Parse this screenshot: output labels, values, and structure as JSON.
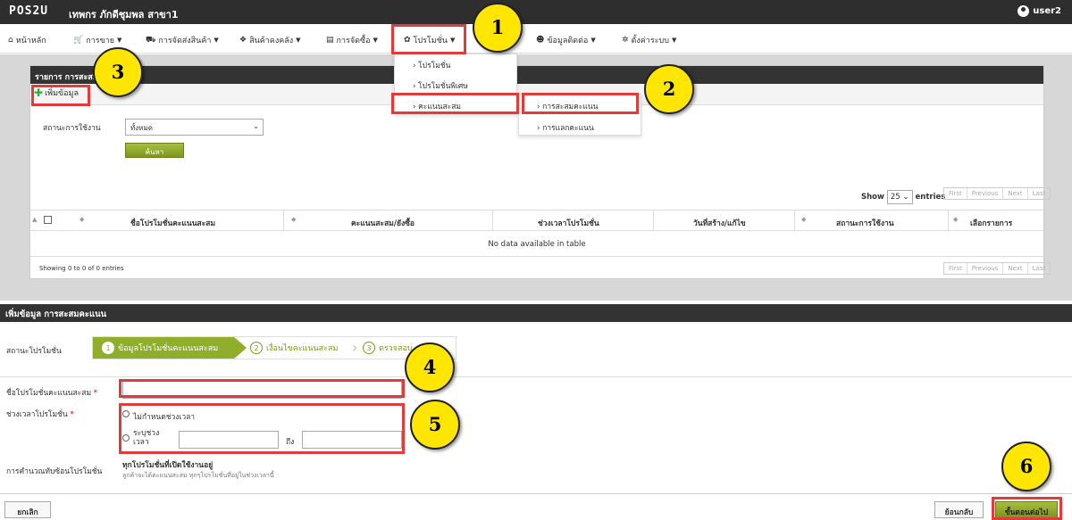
{
  "topbar": {
    "logo": "POS2U",
    "store_name": "เทพกร ภักดีชุมพล สาขา1",
    "user": "user2"
  },
  "nav": [
    {
      "label": "หน้าหลัก",
      "icon": "home-icon",
      "glyph": "⌂"
    },
    {
      "label": "การขาย",
      "icon": "cart-icon",
      "glyph": "🛒"
    },
    {
      "label": "การจัดส่งสินค้า",
      "icon": "truck-icon",
      "glyph": "⛟"
    },
    {
      "label": "สินค้าคงคลัง",
      "icon": "boxes-icon",
      "glyph": "❖"
    },
    {
      "label": "การจัดซื้อ",
      "icon": "document-icon",
      "glyph": "▤"
    },
    {
      "label": "โปรโมชั่น",
      "icon": "gift-icon",
      "glyph": "✿"
    },
    {
      "label": "ข้อมูลติดต่อ",
      "icon": "users-icon",
      "glyph": "☻"
    },
    {
      "label": "ตั้งค่าระบบ",
      "icon": "gear-icon",
      "glyph": "✲"
    }
  ],
  "promo_menu": {
    "items": [
      "โปรโมชั่น",
      "โปรโมชั่นพิเศษ",
      "คะแนนสะสม"
    ],
    "submenu": [
      "การสะสมคะแนน",
      "การแลกคะแนน"
    ]
  },
  "list_panel": {
    "title": "รายการ การสะสมคะแนน",
    "add_label": "เพิ่มข้อมูล",
    "status_label": "สถานะการใช้งาน",
    "status_value": "ทั้งหมด",
    "search_label": "ค้นหา",
    "show_label": "Show",
    "show_value": "25",
    "entries_label": "entries",
    "pager": [
      "First",
      "Previous",
      "Next",
      "Last"
    ],
    "columns": [
      "ชื่อโปรโมชั่นคะแนนสะสม",
      "คะแนนสะสม/ยังซื้อ",
      "ช่วงเวลาโปรโมชั่น",
      "วันที่สร้าง/แก้ไข",
      "สถานะการใช้งาน",
      "เลือกรายการ"
    ],
    "empty_text": "No data available in table",
    "info_text": "Showing 0 to 0 of 0 entries"
  },
  "form": {
    "title": "เพิ่มข้อมูล การสะสมคะแนน",
    "status_label": "สถานะโปรโมชั่น",
    "steps": [
      {
        "num": "1",
        "label": "ข้อมูลโปรโมชั่นคะแนนสะสม"
      },
      {
        "num": "2",
        "label": "เงื่อนไขคะแนนสะสม"
      },
      {
        "num": "3",
        "label": "ตรวจสอบ"
      }
    ],
    "name_label": "ชื่อโปรโมชั่นคะแนนสะสม",
    "name_value": "",
    "req_mark": "*",
    "period_label": "ช่วงเวลาโปรโมชั่น",
    "radio_unlimited": "ไม่กำหนดช่วงเวลา",
    "radio_range_1": "ระบุช่วง",
    "radio_range_2": "เวลา",
    "to_label": "ถึง",
    "calc_label": "การคำนวณทับซ้อนโปรโมชั่น",
    "calc_title": "ทุกโปรโมชั่นที่เปิดใช้งานอยู่",
    "calc_desc": "ลูกค้าจะได้คะแนนสะสม ทุกๆโปรโมชั่นที่อยู่ในช่วงเวลานี้",
    "cancel": "ยกเลิก",
    "back": "ย้อนกลับ",
    "next": "ขั้นตอนต่อไป"
  },
  "callouts": [
    "1",
    "2",
    "3",
    "4",
    "5",
    "6"
  ],
  "colors": {
    "accent_green": "#8fae2b",
    "highlight_red": "#e03c3c",
    "callout_yellow": "#ffe600",
    "dark_bar": "#333333"
  }
}
